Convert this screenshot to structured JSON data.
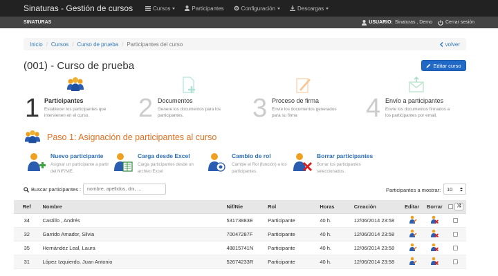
{
  "navbar": {
    "brand": "Sinaturas - Gestión de cursos",
    "items": [
      {
        "label": "Cursos",
        "dropdown": true
      },
      {
        "label": "Participantes",
        "dropdown": false
      },
      {
        "label": "Configuración",
        "dropdown": true
      },
      {
        "label": "Descargas",
        "dropdown": true
      }
    ]
  },
  "subbar": {
    "org": "SINATURAS",
    "user_label": "USUARIO:",
    "user_name": "Sinaturas , Demo",
    "logout": "Cerrar sesión"
  },
  "breadcrumb": {
    "items": [
      "Inicio",
      "Cursos",
      "Curso de prueba"
    ],
    "active": "Participantes del curso",
    "back": "volver"
  },
  "page": {
    "title": "(001) - Curso de prueba",
    "edit_button": "Editar curso"
  },
  "steps": [
    {
      "num": "1",
      "title": "Participantes",
      "desc": "Establecer los participantes que intervienen en el curso."
    },
    {
      "num": "2",
      "title": "Documentos",
      "desc": "Genere los documentos para los participantes."
    },
    {
      "num": "3",
      "title": "Proceso de firma",
      "desc": "Envíe los documentos generados para su firma"
    },
    {
      "num": "4",
      "title": "Envío a participantes",
      "desc": "Envíe los documentos firmados a los participantes por email."
    }
  ],
  "section": {
    "title": "Paso 1: Asignación de participantes al curso"
  },
  "actions": [
    {
      "title": "Nuevo participante",
      "desc": "Asignar un participante a partir del NIF/NIE."
    },
    {
      "title": "Carga desde Excel",
      "desc": "Carga participantes desde un archivo Excel"
    },
    {
      "title": "Cambio de rol",
      "desc": "Cambie el Rol (función) a los participantes."
    },
    {
      "title": "Borrar participantes",
      "desc": "Borrar los participantes seleccionados."
    }
  ],
  "search": {
    "label": "Buscar participantes :",
    "placeholder": "nombre, apellidos, dni, ...",
    "show_label": "Participantes a mostrar:",
    "show_value": "10"
  },
  "table": {
    "headers": {
      "ref": "Ref",
      "nombre": "Nombre",
      "nif": "Nif/Nie",
      "rol": "Rol",
      "horas": "Horas",
      "creacion": "Creación",
      "editar": "Editar",
      "borrar": "Borrar"
    },
    "rows": [
      {
        "ref": "34",
        "nombre": "Castillo , Andrés",
        "nif": "53173883E",
        "rol": "Participante",
        "horas": "40 h.",
        "creacion": "12/06/2014 23:58"
      },
      {
        "ref": "32",
        "nombre": "Garrido Amador, Silvia",
        "nif": "70047287F",
        "rol": "Participante",
        "horas": "40 h.",
        "creacion": "12/06/2014 23:58"
      },
      {
        "ref": "35",
        "nombre": "Hernández Leal, Laura",
        "nif": "48815741N",
        "rol": "Participante",
        "horas": "40 h.",
        "creacion": "12/06/2014 23:58"
      },
      {
        "ref": "31",
        "nombre": "López Izquierdo, Juan Antonio",
        "nif": "52674233R",
        "rol": "Participante",
        "horas": "40 h.",
        "creacion": "12/06/2014 23:58"
      }
    ]
  },
  "colors": {
    "navbar": "#222222",
    "subbar": "#444444",
    "link": "#337ab7",
    "primary": "#2069c7",
    "section_title": "#e07020",
    "action_title": "#2a6fb6"
  }
}
